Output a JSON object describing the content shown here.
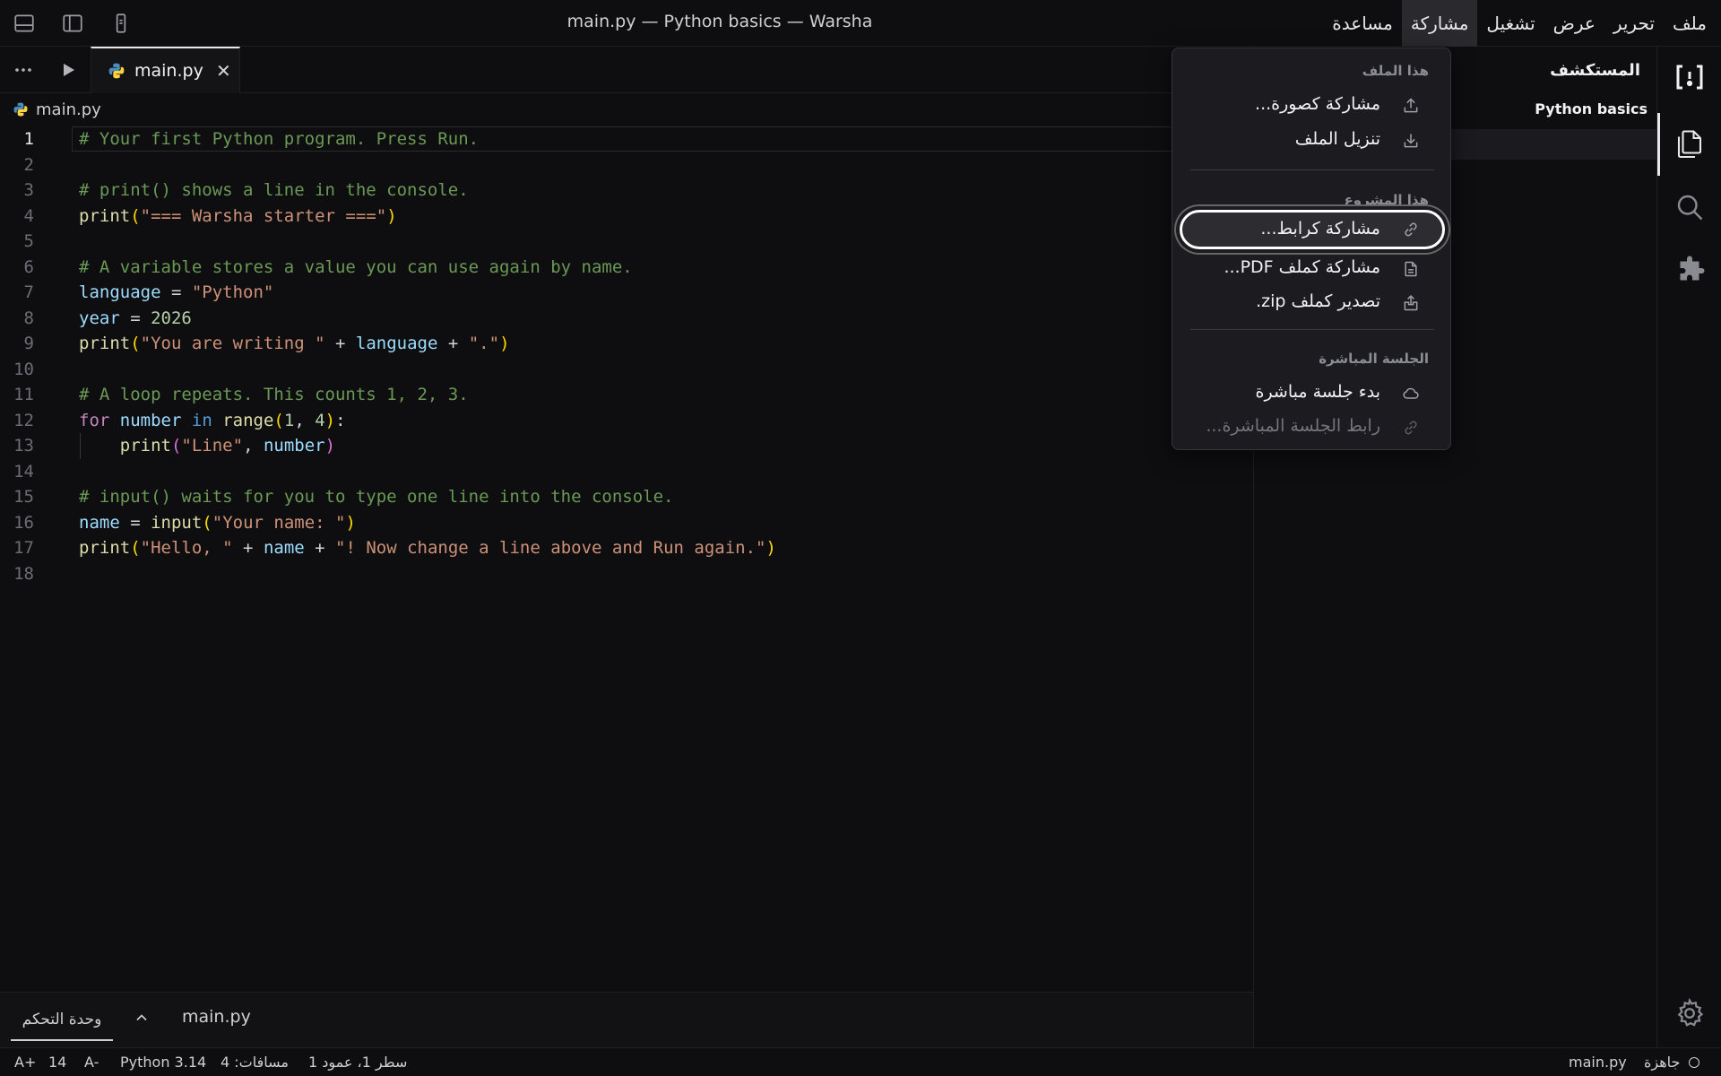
{
  "window": {
    "title": "main.py — Python basics — Warsha"
  },
  "titlebar_icons": [
    "panel-bottom-icon",
    "sidebar-toggle-icon",
    "device-icon"
  ],
  "menubar": {
    "items": [
      {
        "label": "ملف"
      },
      {
        "label": "تحرير"
      },
      {
        "label": "عرض"
      },
      {
        "label": "تشغيل"
      },
      {
        "label": "مشاركة",
        "active": true
      },
      {
        "label": "مساعدة"
      }
    ]
  },
  "explorer": {
    "title": "المستكشف",
    "project": "Python basics"
  },
  "activitybar": {
    "icons": [
      "warsha-logo-icon",
      "files-icon",
      "search-icon",
      "extensions-icon",
      "gear-icon"
    ]
  },
  "editor": {
    "tab": {
      "label": "main.py",
      "icon": "python-icon"
    },
    "breadcrumb": "main.py",
    "current_line": 1,
    "lines": [
      [
        [
          "cm",
          "# Your first Python program. Press Run."
        ]
      ],
      [],
      [
        [
          "cm",
          "# print() shows a line in the console."
        ]
      ],
      [
        [
          "fn",
          "print"
        ],
        [
          "pn",
          "("
        ],
        [
          "st",
          "\"=== Warsha starter ===\""
        ],
        [
          "pn",
          ")"
        ]
      ],
      [],
      [
        [
          "cm",
          "# A variable stores a value you can use again by name."
        ]
      ],
      [
        [
          "vr",
          "language"
        ],
        [
          "op",
          " = "
        ],
        [
          "st",
          "\"Python\""
        ]
      ],
      [
        [
          "vr",
          "year"
        ],
        [
          "op",
          " = "
        ],
        [
          "nm",
          "2026"
        ]
      ],
      [
        [
          "fn",
          "print"
        ],
        [
          "pn",
          "("
        ],
        [
          "st",
          "\"You are writing \""
        ],
        [
          "op",
          " + "
        ],
        [
          "vr",
          "language"
        ],
        [
          "op",
          " + "
        ],
        [
          "st",
          "\".\""
        ],
        [
          "pn",
          ")"
        ]
      ],
      [],
      [
        [
          "cm",
          "# A loop repeats. This counts 1, 2, 3."
        ]
      ],
      [
        [
          "kw",
          "for"
        ],
        [
          "op",
          " "
        ],
        [
          "vr",
          "number"
        ],
        [
          "op",
          " "
        ],
        [
          "kb",
          "in"
        ],
        [
          "op",
          " "
        ],
        [
          "fn",
          "range"
        ],
        [
          "pn",
          "("
        ],
        [
          "nm",
          "1"
        ],
        [
          "op",
          ", "
        ],
        [
          "nm",
          "4"
        ],
        [
          "pn",
          ")"
        ],
        [
          "op",
          ":"
        ]
      ],
      [
        [
          "op",
          "    "
        ],
        [
          "fn",
          "print"
        ],
        [
          "pv",
          "("
        ],
        [
          "st",
          "\"Line\""
        ],
        [
          "op",
          ", "
        ],
        [
          "vr",
          "number"
        ],
        [
          "pv",
          ")"
        ]
      ],
      [],
      [
        [
          "cm",
          "# input() waits for you to type one line into the console."
        ]
      ],
      [
        [
          "vr",
          "name"
        ],
        [
          "op",
          " = "
        ],
        [
          "fn",
          "input"
        ],
        [
          "pn",
          "("
        ],
        [
          "st",
          "\"Your name: \""
        ],
        [
          "pn",
          ")"
        ]
      ],
      [
        [
          "fn",
          "print"
        ],
        [
          "pn",
          "("
        ],
        [
          "st",
          "\"Hello, \""
        ],
        [
          "op",
          " + "
        ],
        [
          "vr",
          "name"
        ],
        [
          "op",
          " + "
        ],
        [
          "st",
          "\"! Now change a line above and Run again.\""
        ],
        [
          "pn",
          ")"
        ]
      ],
      []
    ]
  },
  "panel": {
    "console_tab": "وحدة التحكم",
    "file_label": "main.py"
  },
  "statusbar": {
    "font_increase": "A+",
    "font_size": "14",
    "font_decrease": "A-",
    "language": "Python 3.14",
    "spaces": "مسافات: 4",
    "position": "سطر 1، عمود 1",
    "file": "main.py",
    "status": "جاهزة"
  },
  "share_menu": {
    "section_file": "هذا الملف",
    "share_image": "مشاركة كصورة...",
    "download_file": "تنزيل الملف",
    "section_project": "هذا المشروع",
    "share_link": "مشاركة كرابط...",
    "share_pdf": "مشاركة كملف PDF...",
    "export_zip": "تصدير كملف zip.",
    "section_live": "الجلسة المباشرة",
    "start_live": "بدء جلسة مباشرة",
    "live_link": "رابط الجلسة المباشرة..."
  }
}
